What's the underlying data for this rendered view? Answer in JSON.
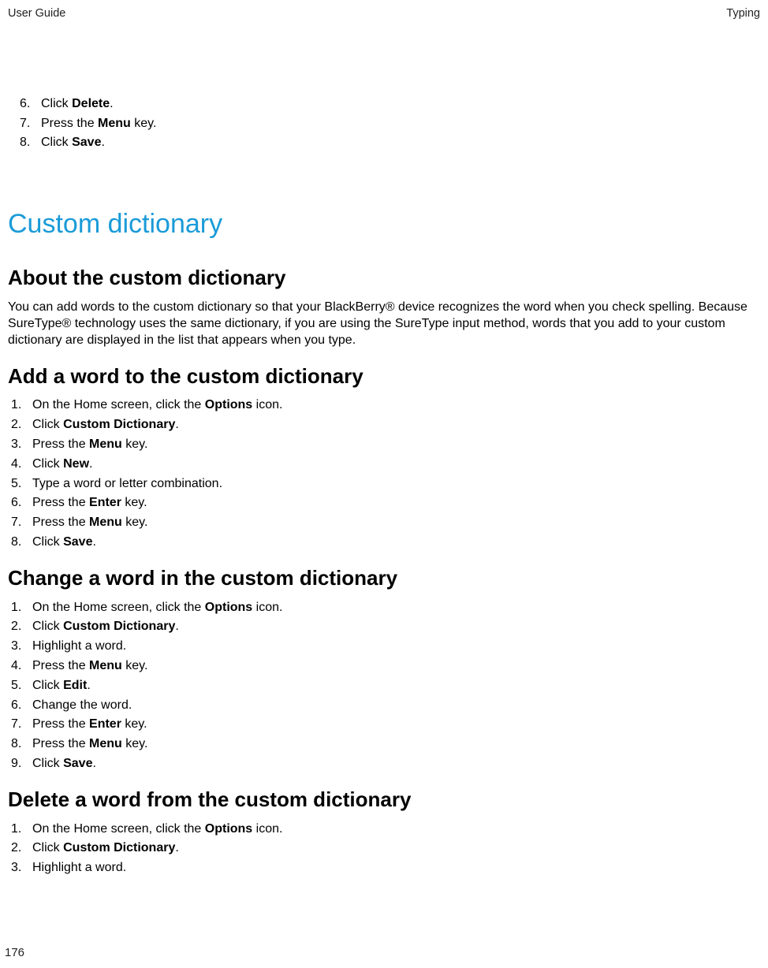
{
  "header": {
    "left": "User Guide",
    "right": "Typing"
  },
  "topSteps": [
    {
      "num": "6.",
      "pre": "Click ",
      "bold": "Delete",
      "post": "."
    },
    {
      "num": "7.",
      "pre": "Press the ",
      "bold": "Menu",
      "post": " key."
    },
    {
      "num": "8.",
      "pre": "Click ",
      "bold": "Save",
      "post": "."
    }
  ],
  "sectionTitle": "Custom dictionary",
  "about": {
    "title": "About the custom dictionary",
    "body": "You can add words to the custom dictionary so that your BlackBerry® device recognizes the word when you check spelling. Because SureType® technology uses the same dictionary, if you are using the SureType input method, words that you add to your custom dictionary are displayed in the list that appears when you type."
  },
  "addWord": {
    "title": "Add a word to the custom dictionary",
    "steps": [
      {
        "num": "1.",
        "pre": "On the Home screen, click the ",
        "bold": "Options",
        "post": " icon."
      },
      {
        "num": "2.",
        "pre": "Click ",
        "bold": "Custom Dictionary",
        "post": "."
      },
      {
        "num": "3.",
        "pre": "Press the ",
        "bold": "Menu",
        "post": " key."
      },
      {
        "num": "4.",
        "pre": "Click ",
        "bold": "New",
        "post": "."
      },
      {
        "num": "5.",
        "pre": "Type a word or letter combination.",
        "bold": "",
        "post": ""
      },
      {
        "num": "6.",
        "pre": "Press the ",
        "bold": "Enter",
        "post": " key."
      },
      {
        "num": "7.",
        "pre": "Press the ",
        "bold": "Menu",
        "post": " key."
      },
      {
        "num": "8.",
        "pre": "Click ",
        "bold": "Save",
        "post": "."
      }
    ]
  },
  "changeWord": {
    "title": "Change a word in the custom dictionary",
    "steps": [
      {
        "num": "1.",
        "pre": "On the Home screen, click the ",
        "bold": "Options",
        "post": " icon."
      },
      {
        "num": "2.",
        "pre": "Click ",
        "bold": "Custom Dictionary",
        "post": "."
      },
      {
        "num": "3.",
        "pre": "Highlight a word.",
        "bold": "",
        "post": ""
      },
      {
        "num": "4.",
        "pre": "Press the ",
        "bold": "Menu",
        "post": " key."
      },
      {
        "num": "5.",
        "pre": "Click ",
        "bold": "Edit",
        "post": "."
      },
      {
        "num": "6.",
        "pre": "Change the word.",
        "bold": "",
        "post": ""
      },
      {
        "num": "7.",
        "pre": "Press the ",
        "bold": "Enter",
        "post": " key."
      },
      {
        "num": "8.",
        "pre": "Press the ",
        "bold": "Menu",
        "post": " key."
      },
      {
        "num": "9.",
        "pre": "Click ",
        "bold": "Save",
        "post": "."
      }
    ]
  },
  "deleteWord": {
    "title": "Delete a word from the custom dictionary",
    "steps": [
      {
        "num": "1.",
        "pre": "On the Home screen, click the ",
        "bold": "Options",
        "post": " icon."
      },
      {
        "num": "2.",
        "pre": "Click ",
        "bold": "Custom Dictionary",
        "post": "."
      },
      {
        "num": "3.",
        "pre": "Highlight a word.",
        "bold": "",
        "post": ""
      }
    ]
  },
  "pageNumber": "176"
}
